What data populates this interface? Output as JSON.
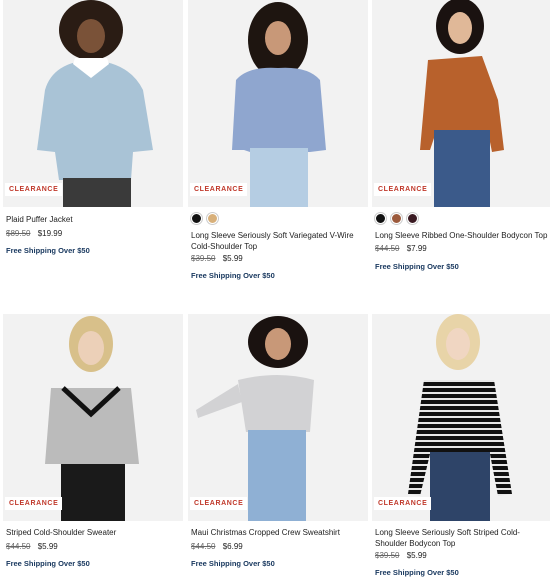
{
  "products": [
    {
      "name": "Plaid Puffer Jacket",
      "badge": "CLEARANCE",
      "was_price": "$89.50",
      "price": "$19.99",
      "shipping": "Free Shipping Over $50",
      "swatches": []
    },
    {
      "name": "Long Sleeve Seriously Soft Variegated V-Wire Cold-Shoulder Top",
      "badge": "CLEARANCE",
      "was_price": "$39.50",
      "price": "$5.99",
      "shipping": "Free Shipping Over $50",
      "swatches": [
        "#111111",
        "#d8b07a"
      ]
    },
    {
      "name": "Long Sleeve Ribbed One-Shoulder Bodycon Top",
      "badge": "CLEARANCE",
      "was_price": "$44.50",
      "price": "$7.99",
      "shipping": "Free Shipping Over $50",
      "swatches": [
        "#111111",
        "#9c5a3c",
        "#3a1a22"
      ]
    },
    {
      "name": "Striped Cold-Shoulder Sweater",
      "badge": "CLEARANCE",
      "was_price": "$44.50",
      "price": "$5.99",
      "shipping": "Free Shipping Over $50",
      "swatches": []
    },
    {
      "name": "Maui Christmas Cropped Crew Sweatshirt",
      "badge": "CLEARANCE",
      "was_price": "$44.50",
      "price": "$6.99",
      "shipping": "Free Shipping Over $50",
      "swatches": []
    },
    {
      "name": "Long Sleeve Seriously Soft Striped Cold-Shoulder Bodycon Top",
      "badge": "CLEARANCE",
      "was_price": "$39.50",
      "price": "$5.99",
      "shipping": "Free Shipping Over $50",
      "swatches": []
    }
  ]
}
